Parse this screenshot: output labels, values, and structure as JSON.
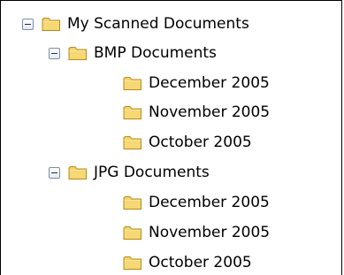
{
  "tree": {
    "root": {
      "label": "My Scanned Documents",
      "expanded": true,
      "children": [
        {
          "label": "BMP Documents",
          "expanded": true,
          "children": [
            {
              "label": "December 2005"
            },
            {
              "label": "November 2005"
            },
            {
              "label": "October 2005"
            }
          ]
        },
        {
          "label": "JPG Documents",
          "expanded": true,
          "children": [
            {
              "label": "December 2005"
            },
            {
              "label": "November 2005"
            },
            {
              "label": "October 2005"
            }
          ]
        }
      ]
    }
  },
  "icons": {
    "toggle": "collapse-minus-icon",
    "folder": "folder-icon"
  },
  "colors": {
    "folder_fill": "#f4d36a",
    "folder_edge": "#b88a1e"
  }
}
